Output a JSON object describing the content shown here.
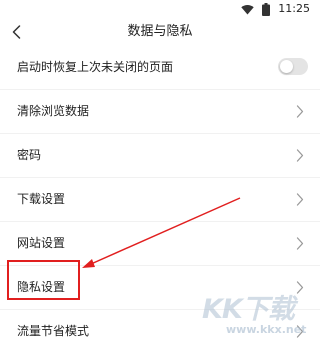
{
  "status_bar": {
    "time": "11:25",
    "icons": [
      "wifi-icon",
      "battery-icon"
    ]
  },
  "header": {
    "title": "数据与隐私",
    "back_icon": "chevron-left-icon"
  },
  "settings": [
    {
      "label": "启动时恢复上次未关闭的页面",
      "control": "toggle",
      "toggle_on": false
    },
    {
      "label": "清除浏览数据",
      "control": "chevron"
    },
    {
      "label": "密码",
      "control": "chevron"
    },
    {
      "label": "下载设置",
      "control": "chevron"
    },
    {
      "label": "网站设置",
      "control": "chevron"
    },
    {
      "label": "隐私设置",
      "control": "chevron",
      "highlighted": true
    },
    {
      "label": "流量节省模式",
      "control": "chevron"
    }
  ],
  "annotation": {
    "color": "#e11f1f",
    "target": "隐私设置"
  },
  "watermark": {
    "logo": "KK下载",
    "url": "www.kkx.net"
  },
  "colors": {
    "background": "#ffffff",
    "text": "#222222",
    "chevron": "#9a9a9a",
    "toggle_off": "#e4e4e4",
    "annotation_red": "#e11f1f"
  }
}
